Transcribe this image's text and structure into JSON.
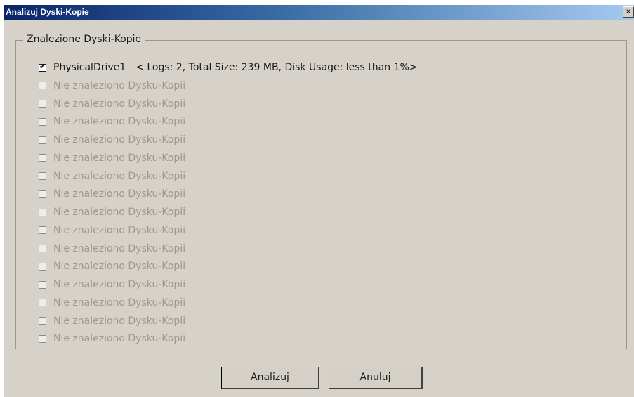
{
  "window": {
    "title": "Analizuj Dyski-Kopie",
    "close_glyph": "×"
  },
  "group": {
    "label": "Znalezione Dyski-Kopie",
    "items": [
      {
        "label": "PhysicalDrive1",
        "details": "< Logs: 2, Total Size: 239 MB, Disk Usage: less than 1%>",
        "checked": true,
        "enabled": true
      },
      {
        "label": "Nie znaleziono Dysku-Kopii",
        "checked": false,
        "enabled": false
      },
      {
        "label": "Nie znaleziono Dysku-Kopii",
        "checked": false,
        "enabled": false
      },
      {
        "label": "Nie znaleziono Dysku-Kopii",
        "checked": false,
        "enabled": false
      },
      {
        "label": "Nie znaleziono Dysku-Kopii",
        "checked": false,
        "enabled": false
      },
      {
        "label": "Nie znaleziono Dysku-Kopii",
        "checked": false,
        "enabled": false
      },
      {
        "label": "Nie znaleziono Dysku-Kopii",
        "checked": false,
        "enabled": false
      },
      {
        "label": "Nie znaleziono Dysku-Kopii",
        "checked": false,
        "enabled": false
      },
      {
        "label": "Nie znaleziono Dysku-Kopii",
        "checked": false,
        "enabled": false
      },
      {
        "label": "Nie znaleziono Dysku-Kopii",
        "checked": false,
        "enabled": false
      },
      {
        "label": "Nie znaleziono Dysku-Kopii",
        "checked": false,
        "enabled": false
      },
      {
        "label": "Nie znaleziono Dysku-Kopii",
        "checked": false,
        "enabled": false
      },
      {
        "label": "Nie znaleziono Dysku-Kopii",
        "checked": false,
        "enabled": false
      },
      {
        "label": "Nie znaleziono Dysku-Kopii",
        "checked": false,
        "enabled": false
      },
      {
        "label": "Nie znaleziono Dysku-Kopii",
        "checked": false,
        "enabled": false
      },
      {
        "label": "Nie znaleziono Dysku-Kopii",
        "checked": false,
        "enabled": false
      }
    ]
  },
  "buttons": {
    "analyze": "Analizuj",
    "cancel": "Anuluj"
  },
  "colors": {
    "titlebar_start": "#0a246a",
    "titlebar_end": "#a6caf0",
    "dialog_face": "#d6d1c9",
    "disabled_text": "#9c9892"
  }
}
